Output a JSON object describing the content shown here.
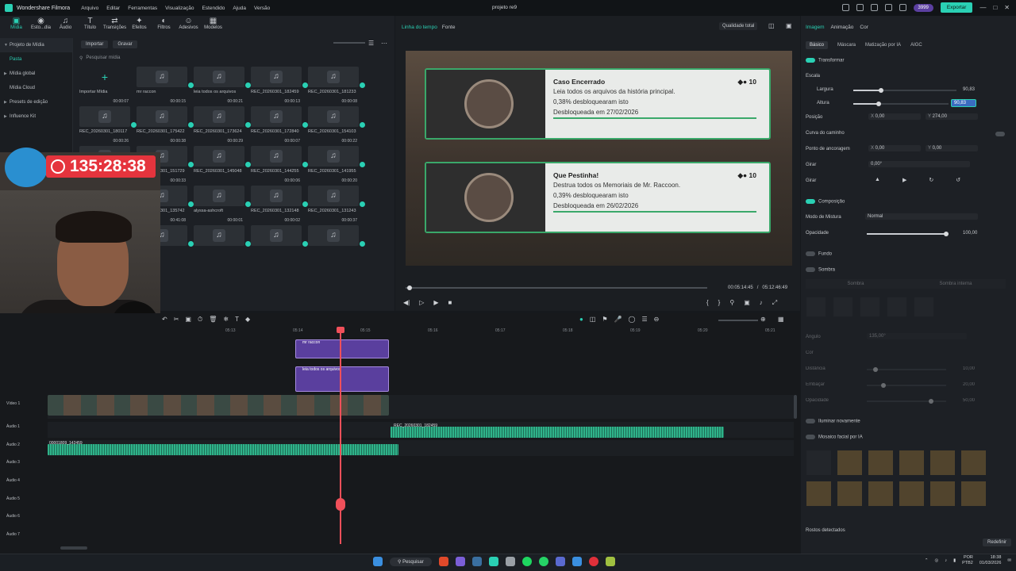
{
  "app": {
    "name": "Wondershare Filmora",
    "project": "projeto re9",
    "menu": [
      "Arquivo",
      "Editar",
      "Ferramentas",
      "Visualização",
      "Estendido",
      "Ajuda",
      "Versão"
    ],
    "credits": "3999",
    "export_label": "Exportar",
    "accent": "#2ad0b4"
  },
  "media_tabs": [
    {
      "label": "Mídia",
      "icon": "media-icon"
    },
    {
      "label": "Esto...dia",
      "icon": "stock-icon"
    },
    {
      "label": "Áudio",
      "icon": "audio-icon"
    },
    {
      "label": "Título",
      "icon": "title-icon"
    },
    {
      "label": "Transições",
      "icon": "transition-icon"
    },
    {
      "label": "Efeitos",
      "icon": "effects-icon"
    },
    {
      "label": "Filtros",
      "icon": "filters-icon"
    },
    {
      "label": "Adesivos",
      "icon": "stickers-icon"
    },
    {
      "label": "Modelos",
      "icon": "templates-icon"
    }
  ],
  "sidebar": [
    {
      "label": "Projeto de Mídia"
    },
    {
      "label": "Pasta"
    },
    {
      "label": "Mídia global"
    },
    {
      "label": "Mídia Cloud"
    },
    {
      "label": "Presets de edição"
    },
    {
      "label": "Influence Kit"
    }
  ],
  "media_toolbar": {
    "import": "Importar",
    "record": "Gravar",
    "search_placeholder": "Pesquisar mídia"
  },
  "media_items": [
    {
      "label": "Importar Mídia",
      "duration": ""
    },
    {
      "label": "mr raccon",
      "duration": ""
    },
    {
      "label": "leia todos os arquivos",
      "duration": ""
    },
    {
      "label": "REC_20260301_182459",
      "duration": ""
    },
    {
      "label": "REC_20260301_181233",
      "duration": ""
    },
    {
      "label": "REC_20260301_180117",
      "duration": "00:00:07"
    },
    {
      "label": "REC_20260301_175422",
      "duration": "00:00:15"
    },
    {
      "label": "REC_20260301_173624",
      "duration": "00:00:21"
    },
    {
      "label": "REC_20260301_172840",
      "duration": "00:00:13"
    },
    {
      "label": "REC_20260301_154103",
      "duration": "00:00:08"
    },
    {
      "label": "REC_20260301_151819",
      "duration": "00:00:26"
    },
    {
      "label": "REC_20260301_151729",
      "duration": "00:00:38"
    },
    {
      "label": "REC_20260301_145048",
      "duration": "00:00:29"
    },
    {
      "label": "REC_20260301_144255",
      "duration": "00:00:07"
    },
    {
      "label": "REC_20260301_141955",
      "duration": "00:00:22"
    },
    {
      "label": "Resident_Evil_Outbrea...",
      "duration": ""
    },
    {
      "label": "REC_20260301_135742",
      "duration": "00:00:33"
    },
    {
      "label": "alyssa-ashcroft",
      "duration": ""
    },
    {
      "label": "REC_20260301_132148",
      "duration": "00:00:06"
    },
    {
      "label": "REC_20260301_131243",
      "duration": "00:00:20"
    },
    {
      "label": "REC_20260301_131142",
      "duration": "00:00:23"
    },
    {
      "label": "pt1",
      "duration": "00:41:08"
    },
    {
      "label": "",
      "duration": "00:00:01"
    },
    {
      "label": "",
      "duration": "00:00:02"
    },
    {
      "label": "",
      "duration": "00:00:37"
    }
  ],
  "overlay": {
    "timer": "135:28:38"
  },
  "preview": {
    "tabs": [
      "Linha do tempo",
      "Fonte"
    ],
    "quality": "Qualidade total",
    "current_time": "00:05:14:45",
    "total_time": "05:12:46:49",
    "progress": 0.01,
    "cards": [
      {
        "title": "Caso Encerrado",
        "desc": "Leia todos os arquivos da história principal.",
        "pct": "0,38% desbloquearam isto",
        "date": "Desbloqueada em 27/02/2026",
        "points": "10"
      },
      {
        "title": "Que Pestinha!",
        "desc": "Destrua todos os Memoriais de Mr. Raccoon.",
        "pct": "0,39% desbloquearam isto",
        "date": "Desbloqueada em 26/02/2026",
        "points": "10"
      }
    ]
  },
  "props": {
    "tabs": [
      "Imagem",
      "Animação",
      "Cor"
    ],
    "subtabs": [
      "Básico",
      "Máscara",
      "Matização por IA",
      "AIGC"
    ],
    "transform": "Transformar",
    "scale": "Escala",
    "width_label": "Largura",
    "width_val": "90,83",
    "height_label": "Altura",
    "height_val": "90,83",
    "position": "Posição",
    "pos_x": "0,00",
    "pos_y": "274,00",
    "path_curve": "Curva do caminho",
    "anchor": "Ponto de ancoragem",
    "anchor_x": "0,00",
    "anchor_y": "0,00",
    "rotate": "Girar",
    "rotate_val": "0,00°",
    "flip": "Girar",
    "composition": "Composição",
    "blend": "Modo de Mistura",
    "blend_val": "Normal",
    "opacity": "Opacidade",
    "opacity_val": "100,00",
    "background": "Fundo",
    "shadow": "Sombra",
    "shadow_tabs": [
      "Sombra",
      "Sombra interna"
    ],
    "angle": "Ângulo",
    "angle_val": "135,00°",
    "color": "Cor",
    "distance": "Distância",
    "distance_val": "10,00",
    "blur": "Embaçar",
    "blur_val": "20,00",
    "shadow_opacity": "Opacidade",
    "shadow_opacity_val": "50,00",
    "relight": "Iluminar novamente",
    "face_mosaic": "Mosaico facial por IA",
    "faces_detected": "Rostos detectados",
    "reset": "Redefinir"
  },
  "timeline": {
    "ruler": [
      "05:13",
      "05:14",
      "05:15",
      "05:16",
      "05:17",
      "05:18",
      "05:19",
      "05:20",
      "05:21"
    ],
    "tracks": [
      "Vídeo 1",
      "Áudio 1",
      "Áudio 2",
      "Áudio 3",
      "Áudio 4",
      "Áudio 5",
      "Áudio 6",
      "Áudio 7"
    ],
    "clips": {
      "c1": "mr raccon",
      "c2": "leia todos os arquivos",
      "c3": "REC_20260301_182459",
      "c4": "00001809_142459"
    }
  },
  "taskbar": {
    "search": "Pesquisar",
    "lang": "POR",
    "kb": "PTB2",
    "time": "18:38",
    "date": "01/03/2026"
  }
}
